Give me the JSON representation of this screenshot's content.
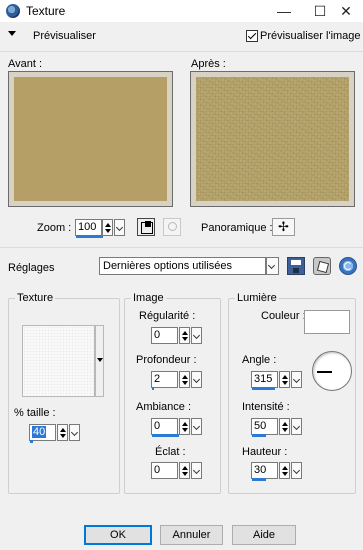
{
  "window": {
    "title": "Texture",
    "min_glyph": "—",
    "max_glyph": "☐",
    "close_glyph": "✕"
  },
  "preview": {
    "toggle_label": "Prévisualiser",
    "checkbox_label": "Prévisualiser l'image",
    "checked": true
  },
  "previews": {
    "before_label": "Avant :",
    "after_label": "Après :"
  },
  "zoom": {
    "label": "Zoom :",
    "value": "100",
    "panoramic_label": "Panoramique :",
    "pan_glyph": "✢"
  },
  "settings": {
    "label": "Réglages",
    "selected": "Dernières options utilisées"
  },
  "texture_group": {
    "title": "Texture",
    "size_label": "% taille :",
    "size_value": "40"
  },
  "image_group": {
    "title": "Image",
    "regularity_label": "Régularité :",
    "regularity_value": "0",
    "depth_label": "Profondeur :",
    "depth_value": "2",
    "ambiance_label": "Ambiance :",
    "ambiance_value": "0",
    "shine_label": "Éclat :",
    "shine_value": "0"
  },
  "light_group": {
    "title": "Lumière",
    "color_label": "Couleur :",
    "color_value": "#ffffff",
    "angle_label": "Angle :",
    "angle_value": "315",
    "intensity_label": "Intensité :",
    "intensity_value": "50",
    "height_label": "Hauteur :",
    "height_value": "30"
  },
  "buttons": {
    "ok": "OK",
    "cancel": "Annuler",
    "help": "Aide"
  },
  "colors": {
    "before_texture": "#b59f67",
    "after_texture": "#b7a56b",
    "accent": "#2b7ad6"
  }
}
